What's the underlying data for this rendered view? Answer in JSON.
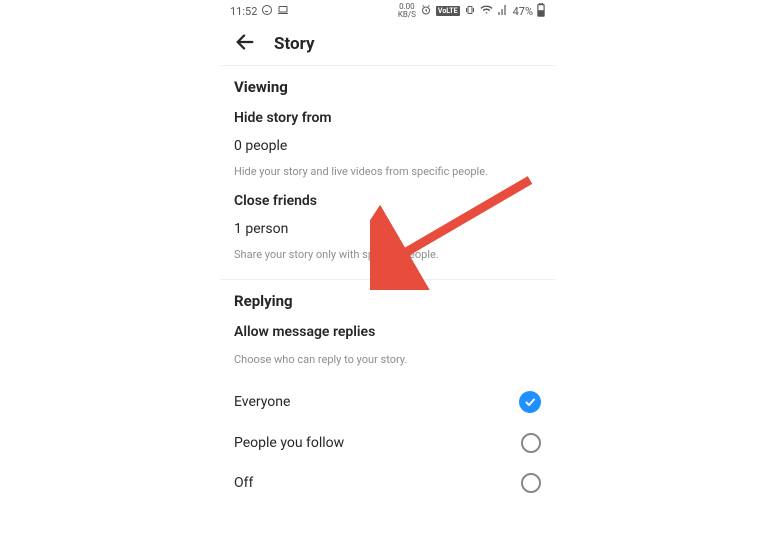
{
  "statusbar": {
    "time": "11:52",
    "net_speed": "0.00",
    "net_unit": "KB/S",
    "volte": "VoLTE",
    "battery_pct": "47%"
  },
  "header": {
    "title": "Story"
  },
  "viewing": {
    "section_title": "Viewing",
    "hide_title": "Hide story from",
    "hide_value": "0 people",
    "hide_desc": "Hide your story and live videos from specific people.",
    "close_title": "Close friends",
    "close_value": "1 person",
    "close_desc": "Share your story only with specific people."
  },
  "replying": {
    "section_title": "Replying",
    "allow_title": "Allow message replies",
    "allow_desc": "Choose who can reply to your story.",
    "options": {
      "everyone": "Everyone",
      "follow": "People you follow",
      "off": "Off"
    },
    "selected": "everyone"
  }
}
